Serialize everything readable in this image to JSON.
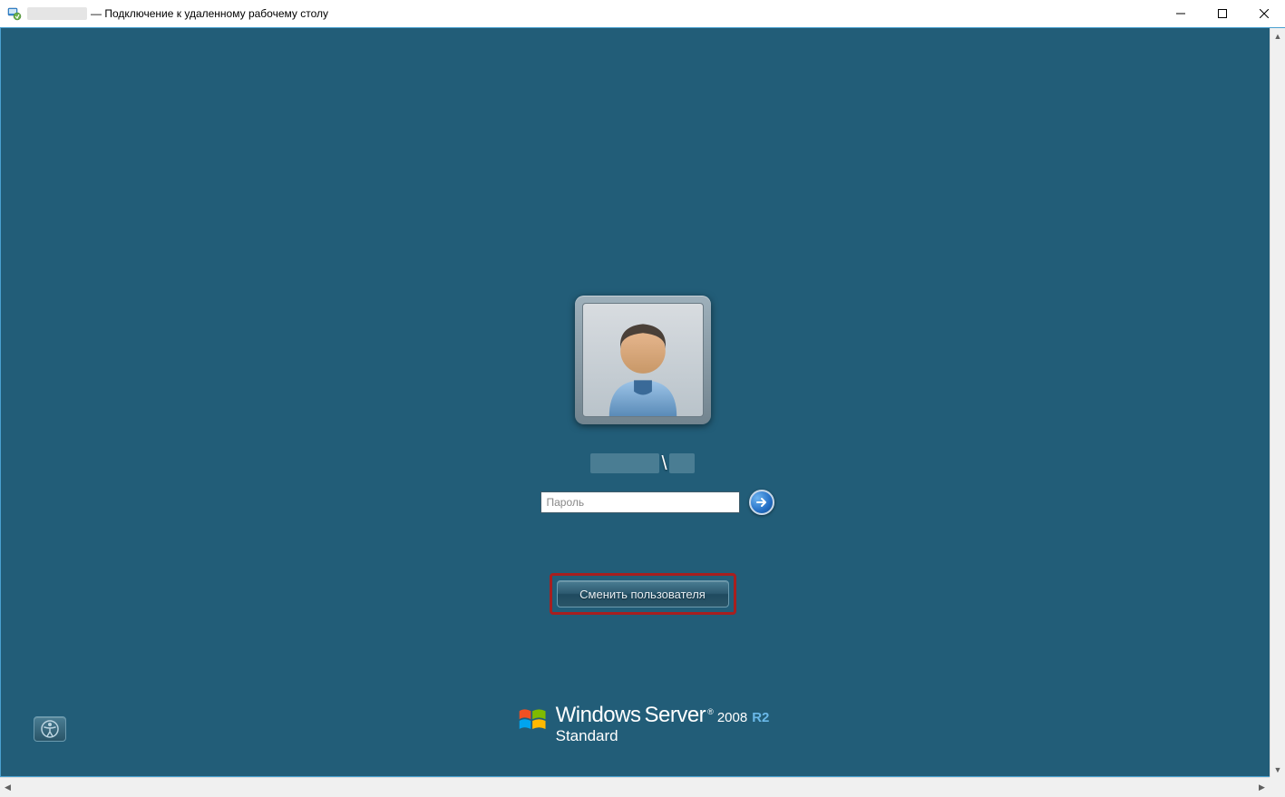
{
  "window": {
    "title_suffix": "— Подключение к удаленному рабочему столу"
  },
  "login": {
    "username_separator": "\\",
    "password_placeholder": "Пароль",
    "switch_user_label": "Сменить пользователя"
  },
  "branding": {
    "windows": "Windows",
    "server": "Server",
    "year": "2008",
    "r2": "R2",
    "registered": "®",
    "edition": "Standard"
  },
  "icons": {
    "rdp": "rdp-icon",
    "user": "user-avatar-icon",
    "arrow": "arrow-right-icon",
    "ease": "ease-of-access-icon",
    "flag": "windows-flag-icon"
  }
}
